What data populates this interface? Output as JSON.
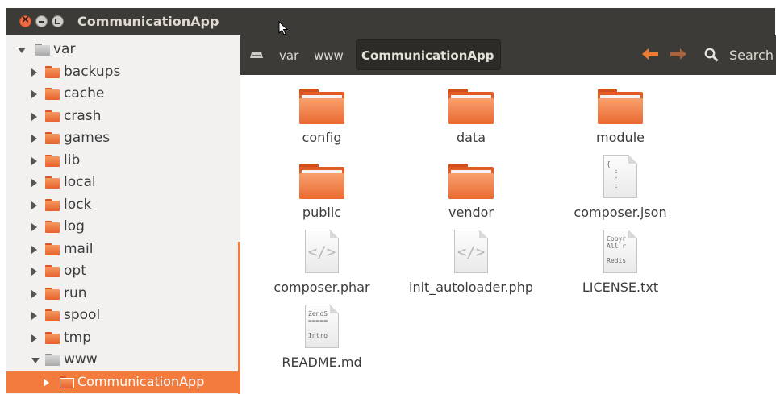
{
  "window": {
    "title": "CommunicationApp"
  },
  "sidebar": {
    "items": [
      {
        "label": "var",
        "level": 0,
        "expanded": true,
        "icon": "grey"
      },
      {
        "label": "backups",
        "level": 1,
        "expanded": false,
        "icon": "orange"
      },
      {
        "label": "cache",
        "level": 1,
        "expanded": false,
        "icon": "orange"
      },
      {
        "label": "crash",
        "level": 1,
        "expanded": false,
        "icon": "orange"
      },
      {
        "label": "games",
        "level": 1,
        "expanded": false,
        "icon": "orange"
      },
      {
        "label": "lib",
        "level": 1,
        "expanded": false,
        "icon": "orange"
      },
      {
        "label": "local",
        "level": 1,
        "expanded": false,
        "icon": "orange"
      },
      {
        "label": "lock",
        "level": 1,
        "expanded": false,
        "icon": "orange"
      },
      {
        "label": "log",
        "level": 1,
        "expanded": false,
        "icon": "orange"
      },
      {
        "label": "mail",
        "level": 1,
        "expanded": false,
        "icon": "orange"
      },
      {
        "label": "opt",
        "level": 1,
        "expanded": false,
        "icon": "orange"
      },
      {
        "label": "run",
        "level": 1,
        "expanded": false,
        "icon": "orange"
      },
      {
        "label": "spool",
        "level": 1,
        "expanded": false,
        "icon": "orange"
      },
      {
        "label": "tmp",
        "level": 1,
        "expanded": false,
        "icon": "orange"
      },
      {
        "label": "www",
        "level": 1,
        "expanded": true,
        "icon": "grey"
      },
      {
        "label": "CommunicationApp",
        "level": 2,
        "expanded": false,
        "icon": "orange",
        "selected": true
      }
    ]
  },
  "pathbar": {
    "crumbs": [
      "var",
      "www"
    ],
    "active": "CommunicationApp",
    "search_label": "Search"
  },
  "files": [
    {
      "name": "config",
      "type": "folder"
    },
    {
      "name": "data",
      "type": "folder"
    },
    {
      "name": "module",
      "type": "folder"
    },
    {
      "name": "public",
      "type": "folder"
    },
    {
      "name": "vendor",
      "type": "folder"
    },
    {
      "name": "composer.json",
      "type": "json",
      "preview": "{\n  :\n  :\n  :"
    },
    {
      "name": "composer.phar",
      "type": "code",
      "preview": "</>"
    },
    {
      "name": "init_autoloader.php",
      "type": "code",
      "preview": "</>"
    },
    {
      "name": "LICENSE.txt",
      "type": "text",
      "preview": "Copyr\nAll r\n\nRedis"
    },
    {
      "name": "README.md",
      "type": "text",
      "preview": "ZendS\n=====\n\nIntro"
    }
  ],
  "colors": {
    "accent": "#f47b3e",
    "titlebar": "#3c3b37",
    "sidebar_bg": "#f2f1f0"
  }
}
